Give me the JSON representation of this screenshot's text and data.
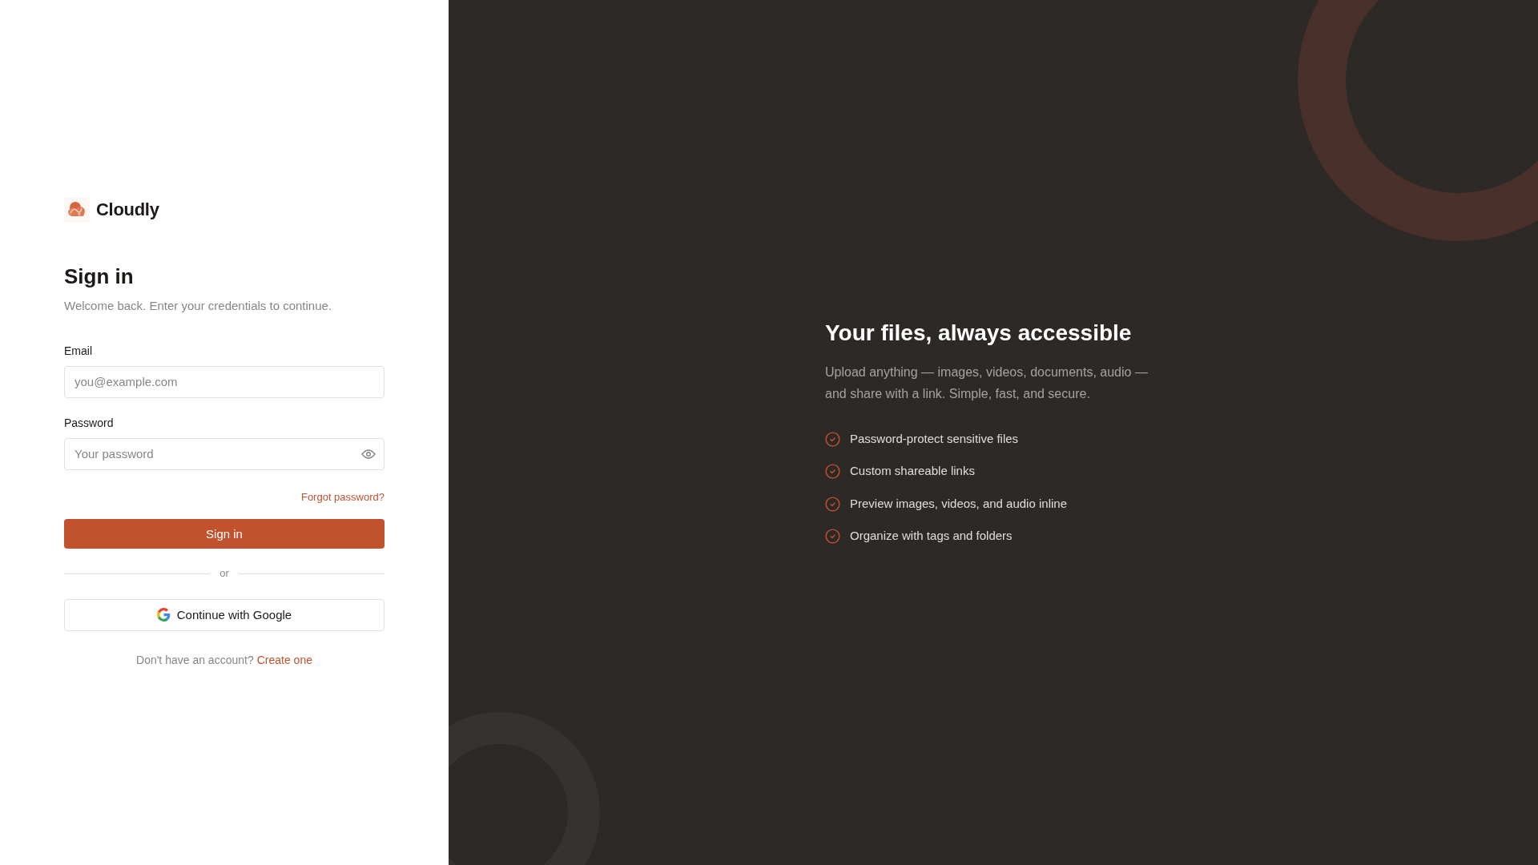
{
  "brand": {
    "name": "Cloudly"
  },
  "signin": {
    "title": "Sign in",
    "subtitle": "Welcome back. Enter your credentials to continue.",
    "fields": [
      {
        "kind": "email",
        "label": "Email",
        "placeholder": "you@example.com"
      },
      {
        "kind": "password",
        "label": "Password",
        "placeholder": "Your password"
      }
    ],
    "forgot_link": "Forgot password?",
    "submit": "Sign in",
    "divider": "or",
    "google_button": "Continue with Google",
    "footer": {
      "text": "Don't have an account?",
      "link": "Create one"
    }
  },
  "promo": {
    "title": "Your files, always accessible",
    "text": "Upload anything — images, videos, documents, audio — and share with a link. Simple, fast, and secure.",
    "features": [
      "Password-protect sensitive files",
      "Custom shareable links",
      "Preview images, videos, and audio inline",
      "Organize with tags and folders"
    ]
  }
}
